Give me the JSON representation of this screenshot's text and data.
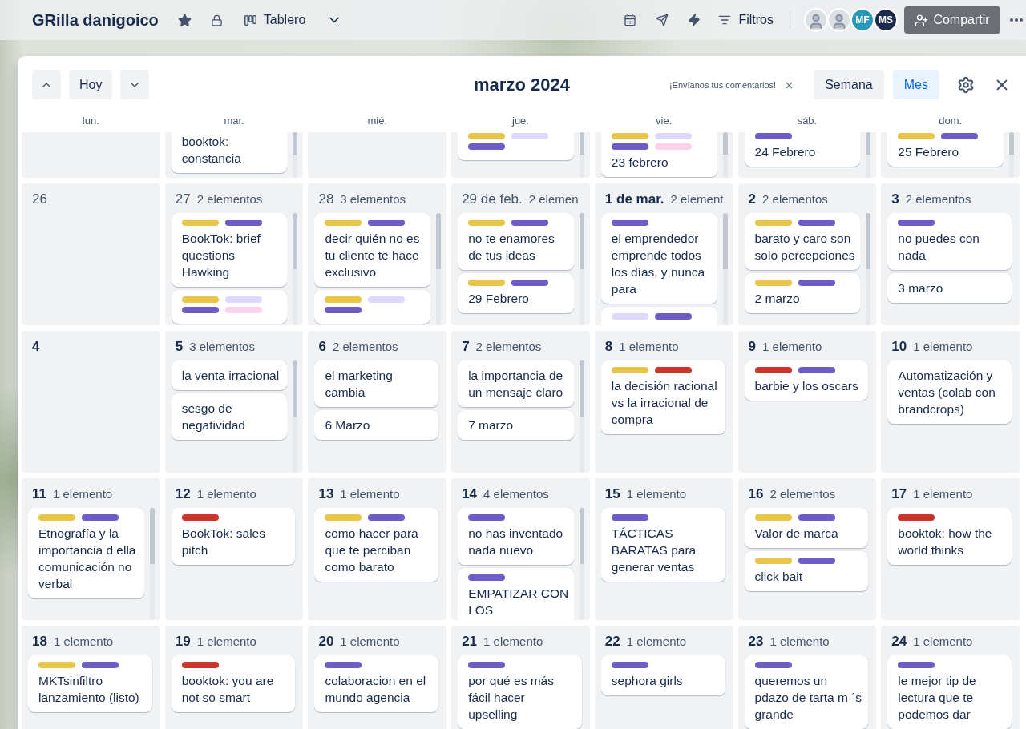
{
  "board": {
    "title": "GRilla danigoico",
    "starred": true,
    "view": "Tablero"
  },
  "toolbar": {
    "filter": "Filtros",
    "members": [
      {
        "kind": "photo"
      },
      {
        "kind": "photo"
      },
      {
        "kind": "initials",
        "initials": "MF",
        "color": "#2898b8"
      },
      {
        "kind": "initials",
        "initials": "MS",
        "color": "#1d2b4f"
      }
    ],
    "share": "Compartir"
  },
  "calendar": {
    "today": "Hoy",
    "title": "marzo 2024",
    "feedback": "¡Envíanos tus comentarios!",
    "views": [
      {
        "label": "Semana",
        "selected": false
      },
      {
        "label": "Mes",
        "selected": true
      }
    ],
    "weekdays": [
      "lun.",
      "mar.",
      "mié.",
      "jue.",
      "vie.",
      "sáb.",
      "dom."
    ],
    "weeks": [
      {
        "partial": true,
        "days": [
          {
            "scrollable": false
          },
          {
            "scrollable": true,
            "cards": [
              {
                "title": "booktok: constancia"
              }
            ]
          },
          {
            "scrollable": false
          },
          {
            "scrollable": true,
            "cards": [
              {
                "labels": [
                  {
                    "color": "#e9c54a"
                  },
                  {
                    "color": "#dfd8fd"
                  },
                  {
                    "color": "#6e5dc6"
                  }
                ]
              }
            ]
          },
          {
            "scrollable": true,
            "cards": [
              {
                "labels": [
                  {
                    "color": "#e9c54a"
                  },
                  {
                    "color": "#dfd8fd"
                  },
                  {
                    "color": "#6e5dc6"
                  },
                  {
                    "color": "#fdd0ec"
                  }
                ],
                "title": "23 febrero"
              }
            ]
          },
          {
            "scrollable": true,
            "cards": [
              {
                "labels": [
                  {
                    "color": "#6e5dc6"
                  }
                ],
                "title": "24 Febrero"
              }
            ]
          },
          {
            "scrollable": true,
            "cards": [
              {
                "labels": [
                  {
                    "color": "#e9c54a"
                  },
                  {
                    "color": "#6e5dc6"
                  }
                ],
                "title": "25 Febrero"
              }
            ]
          }
        ]
      },
      {
        "partial": false,
        "days": [
          {
            "date": "26",
            "in_month": false,
            "scrollable": false
          },
          {
            "date": "27",
            "count": "2 elementos",
            "in_month": false,
            "scrollable": true,
            "cards": [
              {
                "labels": [
                  {
                    "color": "#e9c54a"
                  },
                  {
                    "color": "#6e5dc6"
                  }
                ],
                "title": "BookTok: brief questions Hawking"
              },
              {
                "labels": [
                  {
                    "color": "#e9c54a"
                  },
                  {
                    "color": "#dfd8fd"
                  },
                  {
                    "color": "#6e5dc6"
                  },
                  {
                    "color": "#fdd0ec"
                  }
                ]
              }
            ]
          },
          {
            "date": "28",
            "count": "3 elementos",
            "in_month": false,
            "scrollable": true,
            "cards": [
              {
                "labels": [
                  {
                    "color": "#e9c54a"
                  },
                  {
                    "color": "#6e5dc6"
                  }
                ],
                "title": "decir quién no es tu cliente te hace exclusivo"
              },
              {
                "labels": [
                  {
                    "color": "#e9c54a"
                  },
                  {
                    "color": "#dfd8fd"
                  },
                  {
                    "color": "#6e5dc6"
                  }
                ]
              }
            ]
          },
          {
            "date": "29 de feb.",
            "count": "2 elemen",
            "in_month": false,
            "scrollable": true,
            "cards": [
              {
                "labels": [
                  {
                    "color": "#e9c54a"
                  },
                  {
                    "color": "#6e5dc6"
                  }
                ],
                "title": "no te enamores de tus ideas"
              },
              {
                "labels": [
                  {
                    "color": "#e9c54a"
                  },
                  {
                    "color": "#6e5dc6"
                  }
                ],
                "title": "29 Febrero"
              }
            ]
          },
          {
            "date": "1 de mar.",
            "count": "2 element",
            "in_month": true,
            "scrollable": true,
            "cards": [
              {
                "labels": [
                  {
                    "color": "#6e5dc6"
                  }
                ],
                "title": "el emprendedor emprende todos los días, y nunca para"
              },
              {
                "labels": [
                  {
                    "color": "#dfd8fd"
                  },
                  {
                    "color": "#6e5dc6"
                  }
                ]
              }
            ]
          },
          {
            "date": "2",
            "count": "2 elementos",
            "in_month": true,
            "scrollable": true,
            "cards": [
              {
                "labels": [
                  {
                    "color": "#e9c54a"
                  },
                  {
                    "color": "#6e5dc6"
                  }
                ],
                "title": "barato y caro son solo percepciones"
              },
              {
                "labels": [
                  {
                    "color": "#e9c54a"
                  },
                  {
                    "color": "#6e5dc6"
                  }
                ],
                "title": "2 marzo"
              }
            ]
          },
          {
            "date": "3",
            "count": "2 elementos",
            "in_month": true,
            "scrollable": false,
            "cards": [
              {
                "labels": [
                  {
                    "color": "#6e5dc6"
                  }
                ],
                "title": "no puedes con nada"
              },
              {
                "title": "3 marzo"
              }
            ]
          }
        ]
      },
      {
        "partial": false,
        "days": [
          {
            "date": "4",
            "in_month": true,
            "scrollable": false
          },
          {
            "date": "5",
            "count": "3 elementos",
            "in_month": true,
            "scrollable": true,
            "cards": [
              {
                "title": "la venta irracional"
              },
              {
                "title": "sesgo de negatividad"
              }
            ]
          },
          {
            "date": "6",
            "count": "2 elementos",
            "in_month": true,
            "scrollable": false,
            "cards": [
              {
                "title": "el marketing cambia"
              },
              {
                "title": "6 Marzo"
              }
            ]
          },
          {
            "date": "7",
            "count": "2 elementos",
            "in_month": true,
            "scrollable": true,
            "cards": [
              {
                "title": "la importancia de un mensaje claro"
              },
              {
                "title": "7 marzo"
              }
            ]
          },
          {
            "date": "8",
            "count": "1 elemento",
            "in_month": true,
            "scrollable": false,
            "cards": [
              {
                "labels": [
                  {
                    "color": "#e9c54a"
                  },
                  {
                    "color": "#c9372c"
                  }
                ],
                "title": "la decisión racional vs la irracional de compra"
              }
            ]
          },
          {
            "date": "9",
            "count": "1 elemento",
            "in_month": true,
            "scrollable": false,
            "cards": [
              {
                "labels": [
                  {
                    "color": "#c9372c"
                  },
                  {
                    "color": "#6e5dc6"
                  }
                ],
                "title": "barbie y los oscars"
              }
            ]
          },
          {
            "date": "10",
            "count": "1 elemento",
            "in_month": true,
            "scrollable": false,
            "cards": [
              {
                "title": "Automatización y ventas (colab con brandcrops)"
              }
            ]
          }
        ]
      },
      {
        "partial": false,
        "days": [
          {
            "date": "11",
            "count": "1 elemento",
            "in_month": true,
            "scrollable": true,
            "cards": [
              {
                "labels": [
                  {
                    "color": "#e9c54a"
                  },
                  {
                    "color": "#6e5dc6"
                  }
                ],
                "title": "Etnografía y la importancia d ella comunicación no verbal"
              }
            ]
          },
          {
            "date": "12",
            "count": "1 elemento",
            "in_month": true,
            "scrollable": false,
            "cards": [
              {
                "labels": [
                  {
                    "color": "#c9372c"
                  }
                ],
                "title": "BookTok: sales pitch"
              }
            ]
          },
          {
            "date": "13",
            "count": "1 elemento",
            "in_month": true,
            "scrollable": false,
            "cards": [
              {
                "labels": [
                  {
                    "color": "#e9c54a"
                  },
                  {
                    "color": "#6e5dc6"
                  }
                ],
                "title": "como hacer para que te perciban como barato"
              }
            ]
          },
          {
            "date": "14",
            "count": "4 elementos",
            "in_month": true,
            "scrollable": true,
            "cards": [
              {
                "labels": [
                  {
                    "color": "#6e5dc6"
                  }
                ],
                "title": "no has inventado nada nuevo"
              },
              {
                "labels": [
                  {
                    "color": "#6e5dc6"
                  }
                ],
                "title": "EMPATIZAR CON LOS"
              }
            ]
          },
          {
            "date": "15",
            "count": "1 elemento",
            "in_month": true,
            "scrollable": false,
            "cards": [
              {
                "labels": [
                  {
                    "color": "#6e5dc6"
                  }
                ],
                "title": "TÁCTICAS BARATAS para generar ventas"
              }
            ]
          },
          {
            "date": "16",
            "count": "2 elementos",
            "in_month": true,
            "scrollable": false,
            "cards": [
              {
                "labels": [
                  {
                    "color": "#e9c54a"
                  },
                  {
                    "color": "#6e5dc6"
                  }
                ],
                "title": "Valor de marca"
              },
              {
                "labels": [
                  {
                    "color": "#e9c54a"
                  },
                  {
                    "color": "#6e5dc6"
                  }
                ],
                "title": "click bait"
              }
            ]
          },
          {
            "date": "17",
            "count": "1 elemento",
            "in_month": true,
            "scrollable": false,
            "cards": [
              {
                "labels": [
                  {
                    "color": "#c9372c"
                  }
                ],
                "title": "booktok: how the world thinks"
              }
            ]
          }
        ]
      },
      {
        "partial": false,
        "days": [
          {
            "date": "18",
            "count": "1 elemento",
            "in_month": true,
            "scrollable": false,
            "cards": [
              {
                "labels": [
                  {
                    "color": "#e9c54a"
                  },
                  {
                    "color": "#6e5dc6"
                  }
                ],
                "title": "MKTsinfiltro lanzamiento (listo)"
              }
            ]
          },
          {
            "date": "19",
            "count": "1 elemento",
            "in_month": true,
            "scrollable": false,
            "cards": [
              {
                "labels": [
                  {
                    "color": "#c9372c"
                  }
                ],
                "title": "booktok: you are not so smart"
              }
            ]
          },
          {
            "date": "20",
            "count": "1 elemento",
            "in_month": true,
            "scrollable": false,
            "cards": [
              {
                "labels": [
                  {
                    "color": "#6e5dc6"
                  }
                ],
                "title": "colaboracion en el mundo agencia"
              }
            ]
          },
          {
            "date": "21",
            "count": "1 elemento",
            "in_month": true,
            "scrollable": false,
            "cards": [
              {
                "labels": [
                  {
                    "color": "#6e5dc6"
                  }
                ],
                "title": "por qué es más fácil hacer upselling"
              }
            ]
          },
          {
            "date": "22",
            "count": "1 elemento",
            "in_month": true,
            "scrollable": false,
            "cards": [
              {
                "labels": [
                  {
                    "color": "#6e5dc6"
                  }
                ],
                "title": "sephora girls"
              }
            ]
          },
          {
            "date": "23",
            "count": "1 elemento",
            "in_month": true,
            "scrollable": false,
            "cards": [
              {
                "labels": [
                  {
                    "color": "#6e5dc6"
                  }
                ],
                "title": "queremos un pdazo de tarta m ´s grande"
              }
            ]
          },
          {
            "date": "24",
            "count": "1 elemento",
            "in_month": true,
            "scrollable": false,
            "cards": [
              {
                "labels": [
                  {
                    "color": "#6e5dc6"
                  }
                ],
                "title": "le mejor tip de lectura que te podemos dar"
              }
            ]
          }
        ]
      }
    ]
  }
}
